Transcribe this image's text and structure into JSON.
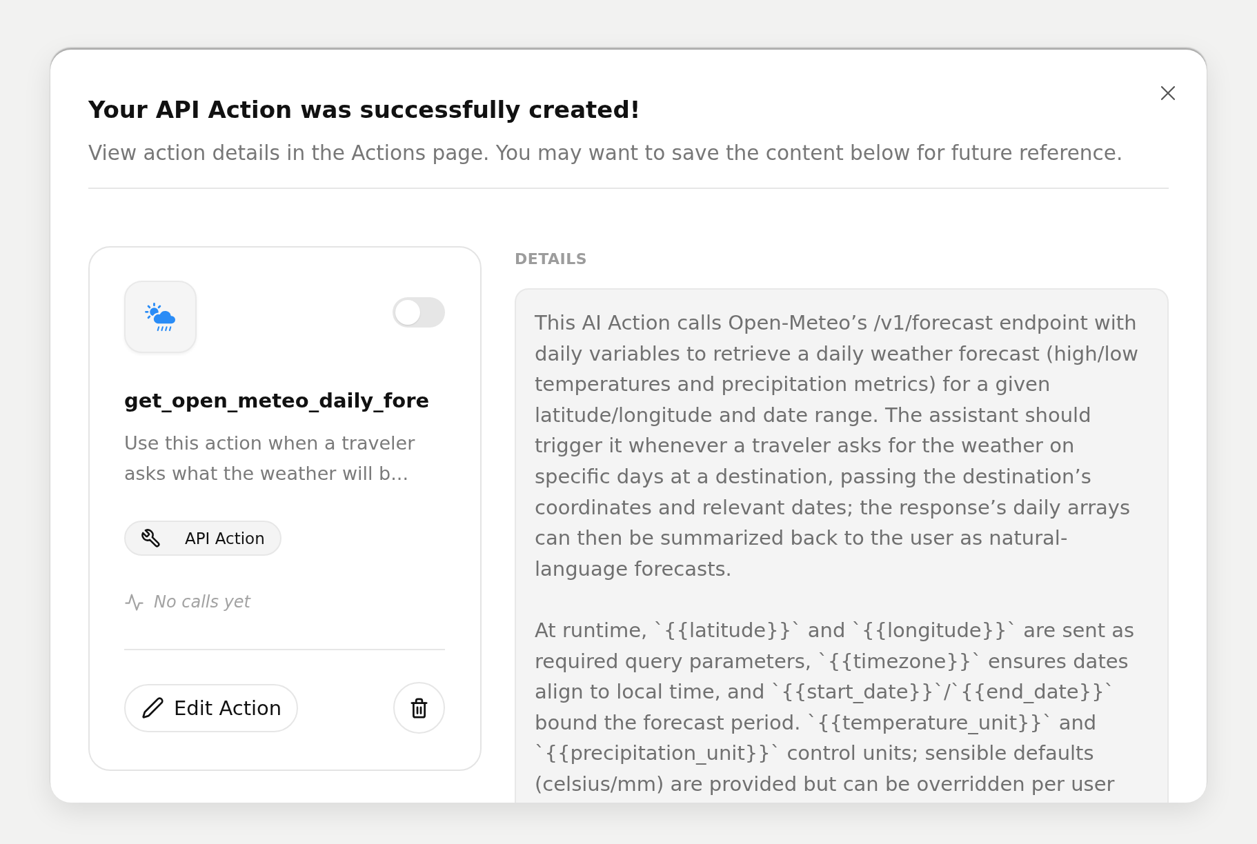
{
  "dialog": {
    "title": "Your API Action was successfully created!",
    "subtitle": "View action details in the Actions page. You may want to save the content below for future reference."
  },
  "action_card": {
    "enabled": false,
    "name": "get_open_meteo_daily_fore",
    "description": "Use this action when a traveler asks what the weather will b...",
    "type_badge": "API Action",
    "usage": "No calls yet",
    "edit_button": "Edit Action"
  },
  "details": {
    "heading": "DETAILS",
    "paragraphs": [
      "This AI Action calls Open-Meteo’s /v1/forecast endpoint with daily variables to retrieve a daily weather forecast (high/low temperatures and precipitation metrics) for a given latitude/longitude and date range. The assistant should trigger it whenever a traveler asks for the weather on specific days at a destination, passing the destination’s coordinates and relevant dates; the response’s daily arrays can then be summarized back to the user as natural-language forecasts.",
      "At runtime, `{{latitude}}` and `{{longitude}}` are sent as required query parameters, `{{timezone}}` ensures dates align to local time, and `{{start_date}}`/`{{end_date}}` bound the forecast period. `{{temperature_unit}}` and `{{precipitation_unit}}` control units; sensible defaults (celsius/mm) are provided but can be overridden per user"
    ]
  }
}
